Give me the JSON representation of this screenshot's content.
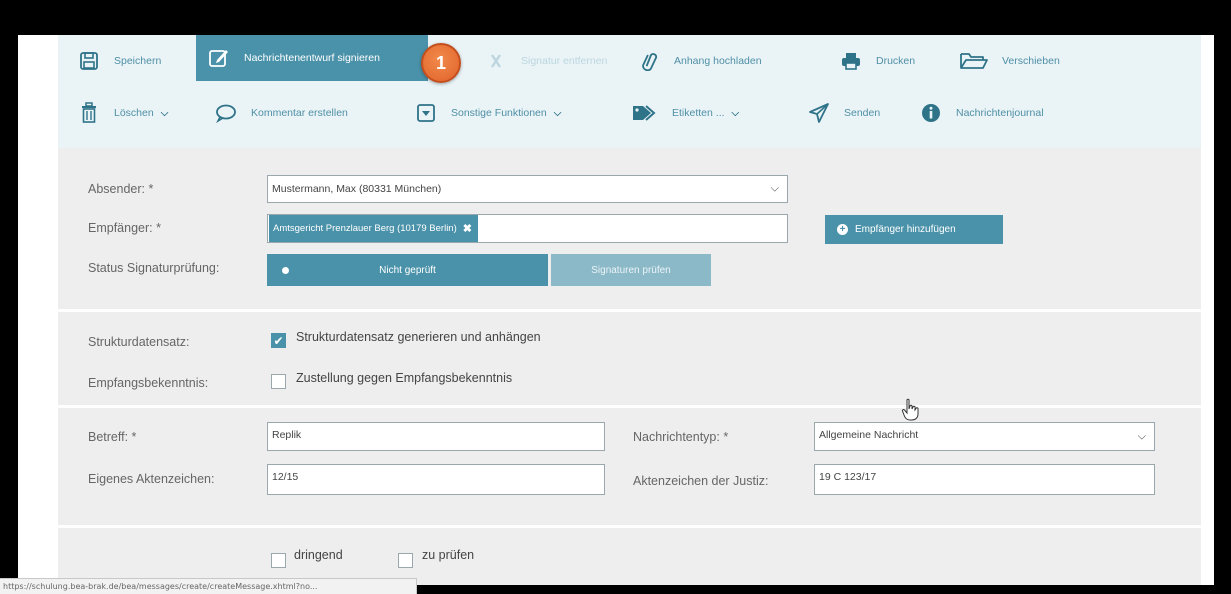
{
  "toolbar": {
    "row1": {
      "save": "Speichern",
      "sign": "Nachrichtenentwurf signieren",
      "remove_sig": "Signatur entfernen",
      "attach": "Anhang hochladen",
      "print": "Drucken",
      "move": "Verschieben"
    },
    "row2": {
      "delete": "Löschen",
      "comment": "Kommentar erstellen",
      "other": "Sonstige Funktionen",
      "labels": "Etiketten ...",
      "send": "Senden",
      "journal": "Nachrichtenjournal"
    },
    "step_badge": "1"
  },
  "form": {
    "sender": {
      "label": "Absender: *",
      "value": "Mustermann, Max (80331 München)"
    },
    "recipient": {
      "label": "Empfänger: *",
      "tag": "Amtsgericht Prenzlauer Berg (10179 Berlin)",
      "add_button": "Empfänger hinzufügen"
    },
    "sig_status": {
      "label": "Status Signaturprüfung:",
      "value": "Nicht geprüft",
      "check_button": "Signaturen prüfen"
    },
    "struct": {
      "label": "Strukturdatensatz:",
      "checkbox": "Strukturdatensatz generieren und anhängen",
      "checked": true
    },
    "receipt": {
      "label": "Empfangsbekenntnis:",
      "checkbox": "Zustellung gegen Empfangsbekenntnis",
      "checked": false
    },
    "subject": {
      "label": "Betreff: *",
      "value": "Replik"
    },
    "msgtype": {
      "label": "Nachrichtentyp: *",
      "value": "Allgemeine Nachricht"
    },
    "own_ref": {
      "label": "Eigenes Aktenzeichen:",
      "value": "12/15"
    },
    "court_ref": {
      "label": "Aktenzeichen der Justiz:",
      "value": "19 C 123/17"
    },
    "urgent": {
      "label": "dringend",
      "checked": false
    },
    "review": {
      "label": "zu prüfen",
      "checked": false
    }
  },
  "statusbar": {
    "url": "https://schulung.bea-brak.de/bea/messages/create/createMessage.xhtml?no..."
  },
  "colors": {
    "accent": "#4a92a9",
    "badge": "#e2622a",
    "toolbar_bg": "#eaf4f7",
    "form_bg": "#eeeeee"
  }
}
